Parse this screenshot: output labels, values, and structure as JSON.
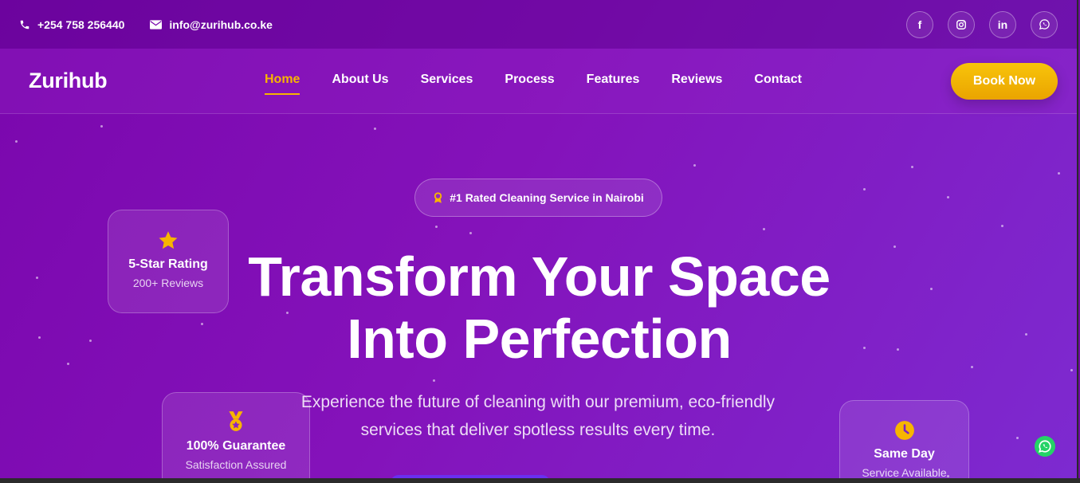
{
  "topbar": {
    "phone": "+254 758 256440",
    "email": "info@zurihub.co.ke",
    "socials": [
      {
        "icon": "facebook-icon",
        "glyph": "f"
      },
      {
        "icon": "instagram-icon",
        "glyph": ""
      },
      {
        "icon": "linkedin-icon",
        "glyph": "in"
      },
      {
        "icon": "whatsapp-icon",
        "glyph": ""
      }
    ]
  },
  "nav": {
    "logo": "Zurihub",
    "items": [
      "Home",
      "About Us",
      "Services",
      "Process",
      "Features",
      "Reviews",
      "Contact"
    ],
    "active": "Home",
    "cta": "Book Now"
  },
  "hero": {
    "badge": "#1 Rated Cleaning Service in Nairobi",
    "title_line1": "Transform Your Space",
    "title_line2": "Into Perfection",
    "subtitle": "Experience the future of cleaning with our premium, eco-friendly services that deliver spotless results every time."
  },
  "cards": [
    {
      "icon": "star-icon",
      "title": "5-Star Rating",
      "sub": "200+ Reviews"
    },
    {
      "icon": "medal-icon",
      "title": "100% Guarantee",
      "sub": "Satisfaction Assured"
    },
    {
      "icon": "clock-icon",
      "title": "Same Day",
      "sub": "Service Available"
    }
  ],
  "colors": {
    "accent": "#f7b500",
    "background": "#8412ba",
    "whatsapp": "#25d366"
  }
}
